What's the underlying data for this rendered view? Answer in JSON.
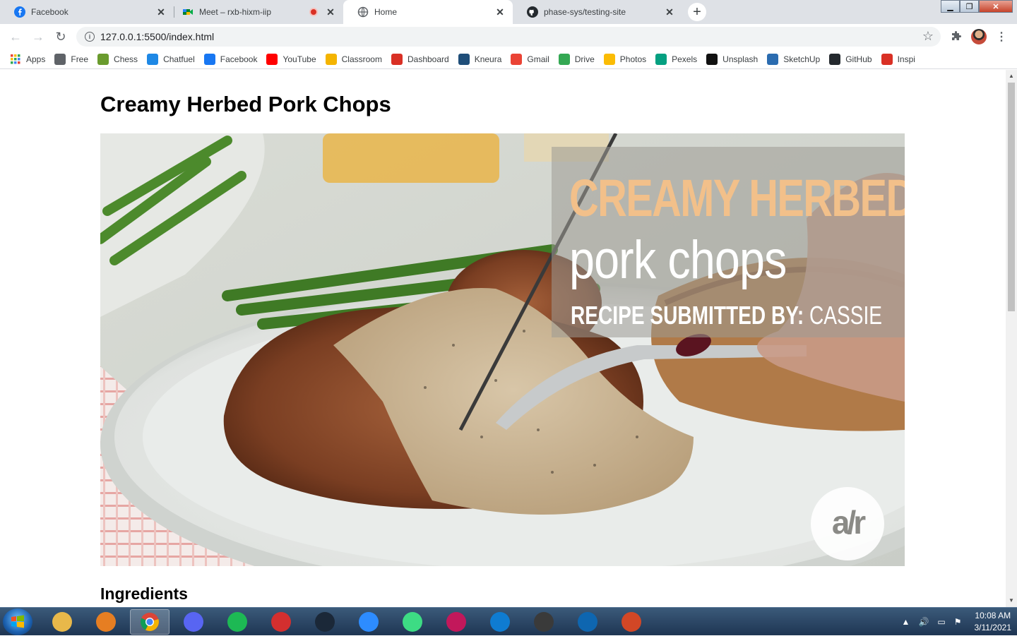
{
  "browser": {
    "tabs": [
      {
        "title": "Facebook",
        "icon": "facebook-icon",
        "active": false
      },
      {
        "title": "Meet – rxb-hixm-iip",
        "icon": "google-meet-icon",
        "active": false,
        "recording": true
      },
      {
        "title": "Home",
        "icon": "globe-icon",
        "active": true
      },
      {
        "title": "phase-sys/testing-site",
        "icon": "github-icon",
        "active": false
      }
    ],
    "address": "127.0.0.1:5500/index.html",
    "bookmarks": [
      {
        "label": "Apps",
        "icon": "apps-grid-icon",
        "color": "#4285f4"
      },
      {
        "label": "Free",
        "icon": "infinity-icon",
        "color": "#5f6368"
      },
      {
        "label": "Chess",
        "icon": "chess-pawn-icon",
        "color": "#6a9b2e"
      },
      {
        "label": "Chatfuel",
        "icon": "chatfuel-icon",
        "color": "#1e88e5"
      },
      {
        "label": "Facebook",
        "icon": "facebook-icon",
        "color": "#1877f2"
      },
      {
        "label": "YouTube",
        "icon": "youtube-icon",
        "color": "#ff0000"
      },
      {
        "label": "Classroom",
        "icon": "classroom-icon",
        "color": "#f4b400"
      },
      {
        "label": "Dashboard",
        "icon": "dashboard-icon",
        "color": "#d93025"
      },
      {
        "label": "Kneura",
        "icon": "kneura-icon",
        "color": "#1f4e79"
      },
      {
        "label": "Gmail",
        "icon": "gmail-icon",
        "color": "#ea4335"
      },
      {
        "label": "Drive",
        "icon": "drive-icon",
        "color": "#34a853"
      },
      {
        "label": "Photos",
        "icon": "photos-icon",
        "color": "#fbbc05"
      },
      {
        "label": "Pexels",
        "icon": "pexels-icon",
        "color": "#05a081"
      },
      {
        "label": "Unsplash",
        "icon": "unsplash-icon",
        "color": "#111111"
      },
      {
        "label": "SketchUp",
        "icon": "sketchup-icon",
        "color": "#2b6cb0"
      },
      {
        "label": "GitHub",
        "icon": "github-icon",
        "color": "#24292e"
      },
      {
        "label": "Inspi",
        "icon": "inspi-icon",
        "color": "#d93025"
      }
    ]
  },
  "page": {
    "title": "Creamy Herbed Pork Chops",
    "hero": {
      "overlay_line1": "CREAMY HERBED",
      "overlay_line2": "pork chops",
      "overlay_line3_bold": "RECIPE SUBMITTED BY:",
      "overlay_line3_name": "CASSIE",
      "logo": "a/r"
    },
    "section_heading": "Ingredients"
  },
  "taskbar": {
    "apps": [
      {
        "name": "file-explorer-icon",
        "color": "#e8b84a"
      },
      {
        "name": "media-player-icon",
        "color": "#e67e22"
      },
      {
        "name": "chrome-icon",
        "color": "#ffffff",
        "active": true
      },
      {
        "name": "discord-icon",
        "color": "#5865f2"
      },
      {
        "name": "spotify-icon",
        "color": "#1db954"
      },
      {
        "name": "garena-icon",
        "color": "#d32f2f"
      },
      {
        "name": "steam-icon",
        "color": "#1b2838"
      },
      {
        "name": "zoom-icon",
        "color": "#2d8cff"
      },
      {
        "name": "android-studio-icon",
        "color": "#3ddc84"
      },
      {
        "name": "snipping-tool-icon",
        "color": "#c2185b"
      },
      {
        "name": "edge-icon",
        "color": "#0f7cd1"
      },
      {
        "name": "terminal-icon",
        "color": "#3a3a3a"
      },
      {
        "name": "vscode-icon",
        "color": "#0e66b0"
      },
      {
        "name": "powerpoint-icon",
        "color": "#d24726"
      }
    ],
    "time": "10:08 AM",
    "date": "3/11/2021"
  }
}
